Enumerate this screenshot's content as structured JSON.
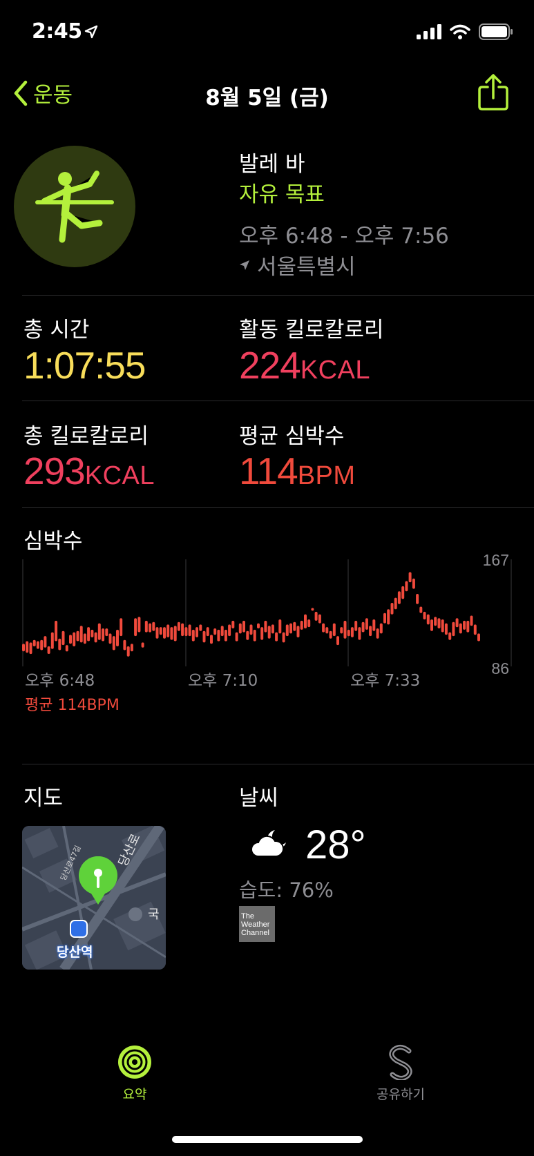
{
  "status_bar": {
    "time": "2:45"
  },
  "nav": {
    "back_label": "운동",
    "title": "8월 5일 (금)"
  },
  "workout": {
    "name": "발레 바",
    "goal": "자유 목표",
    "time_range": "오후 6:48 - 오후 7:56",
    "location": "서울특별시"
  },
  "stats": {
    "total_time_label": "총 시간",
    "total_time_value": "1:07:55",
    "active_kcal_label": "활동 킬로칼로리",
    "active_kcal_value": "224",
    "active_kcal_unit": "KCAL",
    "total_kcal_label": "총 킬로칼로리",
    "total_kcal_value": "293",
    "total_kcal_unit": "KCAL",
    "avg_hr_label": "평균 심박수",
    "avg_hr_value": "114",
    "avg_hr_unit": "BPM"
  },
  "heart_chart": {
    "title": "심박수",
    "y_max_label": "167",
    "y_min_label": "86",
    "x_labels": [
      "오후 6:48",
      "오후 7:10",
      "오후 7:33"
    ],
    "average_label": "평균 114BPM"
  },
  "chart_data": {
    "type": "bar",
    "title": "심박수",
    "ylim": [
      86,
      167
    ],
    "x_tick_labels": [
      "오후 6:48",
      "오후 7:10",
      "오후 7:33"
    ],
    "series": [
      {
        "values": [
          [
            95,
            101
          ],
          [
            94,
            103
          ],
          [
            93,
            102
          ],
          [
            99,
            104
          ],
          [
            97,
            103
          ],
          [
            96,
            104
          ],
          [
            98,
            107
          ],
          [
            93,
            99
          ],
          [
            97,
            110
          ],
          [
            103,
            119
          ],
          [
            96,
            105
          ],
          [
            100,
            111
          ],
          [
            95,
            100
          ],
          [
            101,
            108
          ],
          [
            99,
            110
          ],
          [
            103,
            111
          ],
          [
            102,
            115
          ],
          [
            101,
            109
          ],
          [
            103,
            114
          ],
          [
            106,
            112
          ],
          [
            102,
            110
          ],
          [
            104,
            117
          ],
          [
            103,
            113
          ],
          [
            107,
            113
          ],
          [
            101,
            109
          ],
          [
            96,
            107
          ],
          [
            99,
            112
          ],
          [
            107,
            121
          ],
          [
            96,
            104
          ],
          [
            91,
            99
          ],
          [
            95,
            101
          ],
          [
            107,
            121
          ],
          [
            110,
            122
          ],
          [
            98,
            102
          ],
          [
            110,
            119
          ],
          [
            110,
            117
          ],
          [
            111,
            118
          ],
          [
            105,
            114
          ],
          [
            108,
            114
          ],
          [
            105,
            114
          ],
          [
            106,
            116
          ],
          [
            104,
            114
          ],
          [
            103,
            115
          ],
          [
            111,
            118
          ],
          [
            107,
            117
          ],
          [
            107,
            114
          ],
          [
            107,
            116
          ],
          [
            103,
            112
          ],
          [
            106,
            114
          ],
          [
            111,
            116
          ],
          [
            102,
            111
          ],
          [
            107,
            114
          ],
          [
            101,
            108
          ],
          [
            108,
            113
          ],
          [
            103,
            112
          ],
          [
            107,
            115
          ],
          [
            103,
            112
          ],
          [
            107,
            116
          ],
          [
            113,
            119
          ],
          [
            103,
            110
          ],
          [
            109,
            117
          ],
          [
            110,
            119
          ],
          [
            104,
            111
          ],
          [
            108,
            116
          ],
          [
            103,
            112
          ],
          [
            113,
            117
          ],
          [
            104,
            114
          ],
          [
            110,
            119
          ],
          [
            105,
            115
          ],
          [
            109,
            116
          ],
          [
            103,
            110
          ],
          [
            109,
            120
          ],
          [
            102,
            110
          ],
          [
            107,
            116
          ],
          [
            109,
            117
          ],
          [
            111,
            118
          ],
          [
            106,
            115
          ],
          [
            112,
            119
          ],
          [
            113,
            124
          ],
          [
            114,
            120
          ],
          [
            127,
            129
          ],
          [
            119,
            126
          ],
          [
            117,
            124
          ],
          [
            110,
            117
          ],
          [
            109,
            114
          ],
          [
            105,
            111
          ],
          [
            107,
            117
          ],
          [
            100,
            107
          ],
          [
            109,
            114
          ],
          [
            105,
            119
          ],
          [
            107,
            112
          ],
          [
            106,
            114
          ],
          [
            111,
            119
          ],
          [
            104,
            114
          ],
          [
            110,
            118
          ],
          [
            112,
            121
          ],
          [
            107,
            115
          ],
          [
            111,
            120
          ],
          [
            105,
            113
          ],
          [
            109,
            117
          ],
          [
            117,
            125
          ],
          [
            116,
            128
          ],
          [
            124,
            133
          ],
          [
            128,
            137
          ],
          [
            132,
            142
          ],
          [
            136,
            146
          ],
          [
            142,
            150
          ],
          [
            149,
            157
          ],
          [
            144,
            152
          ],
          [
            132,
            140
          ],
          [
            125,
            130
          ],
          [
            120,
            126
          ],
          [
            116,
            124
          ],
          [
            111,
            120
          ],
          [
            115,
            122
          ],
          [
            113,
            121
          ],
          [
            110,
            120
          ],
          [
            108,
            117
          ],
          [
            104,
            110
          ],
          [
            107,
            118
          ],
          [
            114,
            121
          ],
          [
            109,
            117
          ],
          [
            112,
            119
          ],
          [
            110,
            119
          ],
          [
            115,
            123
          ],
          [
            108,
            116
          ],
          [
            103,
            109
          ]
        ]
      }
    ]
  },
  "map": {
    "title": "지도",
    "station_label": "당산역",
    "street1": "당산로47길",
    "street2": "당산로",
    "poi": "국"
  },
  "weather": {
    "title": "날씨",
    "icon": "partly-cloudy-night-icon",
    "temperature": "28°",
    "humidity": "습도: 76%",
    "provider_logo_text": "The Weather Channel"
  },
  "tabs": [
    {
      "label": "요약",
      "icon": "activity-rings-icon",
      "active": true
    },
    {
      "label": "공유하기",
      "icon": "sharing-icon",
      "active": false
    }
  ],
  "colors": {
    "accent": "#b4f03c",
    "time": "#f8dd5a",
    "calories": "#f0405e",
    "heart_rate": "#f04a3c",
    "secondary_text": "#8e8e93"
  }
}
